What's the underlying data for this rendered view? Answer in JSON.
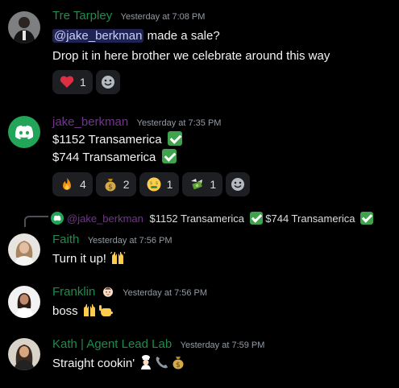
{
  "messages": [
    {
      "author": "Tre Tarpley",
      "timestamp": "Yesterday at 7:08 PM",
      "mention": "@jake_berkman",
      "line1_rest": " made a sale?",
      "line2": "Drop it in here brother we celebrate around this way",
      "reactions": [
        {
          "emoji": "heart-icon",
          "count": "1"
        }
      ]
    },
    {
      "author": "jake_berkman",
      "timestamp": "Yesterday at 7:35 PM",
      "line1": "$1152 Transamerica ",
      "line2": "$744 Transamerica ",
      "reactions": [
        {
          "emoji": "fire-icon",
          "count": "4"
        },
        {
          "emoji": "money-bag-icon",
          "count": "2"
        },
        {
          "emoji": "money-mouth-face-icon",
          "count": "1"
        },
        {
          "emoji": "money-with-wings-icon",
          "count": "1"
        }
      ]
    },
    {
      "reply_author": "@jake_berkman",
      "reply_text1": " $1152 Transamerica ",
      "reply_text2": " $744 Transamerica ",
      "author": "Faith",
      "timestamp": "Yesterday at 7:56 PM",
      "line1": "Turn it up!"
    },
    {
      "author": "Franklin",
      "timestamp": "Yesterday at 7:56 PM",
      "line1": "boss "
    },
    {
      "author": "Kath | Agent Lead Lab",
      "timestamp": "Yesterday at 7:59 PM",
      "line1": "Straight cookin' "
    }
  ],
  "colors": {
    "background": "#000000",
    "author_green": "#1f8b4c",
    "author_purple": "#71368a",
    "discord_green": "#23a559",
    "check_green": "#3fa24c"
  }
}
